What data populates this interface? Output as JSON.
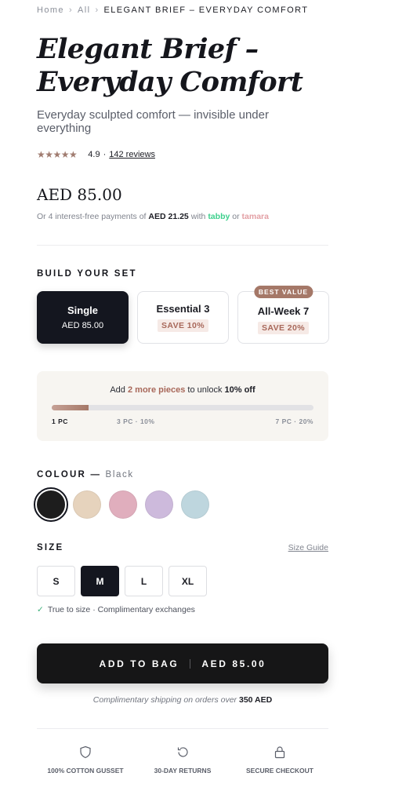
{
  "breadcrumb": {
    "home": "Home",
    "all": "All",
    "separator": "›",
    "current": "ELEGANT BRIEF – EVERYDAY COMFORT"
  },
  "product": {
    "title_line1": "Elegant Brief –",
    "title_line2": "Everyday Comfort",
    "subtitle": "Everyday sculpted comfort — invisible under everything",
    "stars": "★★★★★",
    "rating": "4.9",
    "rating_separator": "·",
    "reviews": "142 reviews",
    "price": "AED 85.00",
    "installments_prefix": "Or 4 interest-free payments of",
    "installment_amount": "AED 21.25",
    "installments_with": "with",
    "provider_1": "tabby",
    "installments_or": "or",
    "provider_2": "tamara"
  },
  "build_set": {
    "label": "BUILD YOUR SET",
    "options": [
      {
        "name": "Single",
        "detail": "AED 85.00",
        "selected": true
      },
      {
        "name": "Essential 3",
        "detail": "SAVE 10%"
      },
      {
        "name": "All-Week 7",
        "detail": "SAVE 20%",
        "badge": "BEST VALUE"
      }
    ]
  },
  "promo": {
    "prefix": "Add",
    "highlight": "2 more pieces",
    "middle": "to unlock",
    "reward": "10% off",
    "progress_fraction": 0.14,
    "ticks": [
      "1 PC",
      "3 PC · 10%",
      "7 PC · 20%"
    ]
  },
  "colour": {
    "label": "COLOUR",
    "dash": "—",
    "selected": "Black",
    "swatches": [
      "#1d1d1d",
      "#e6d3bd",
      "#e0aebd",
      "#cdbadc",
      "#bed6de"
    ]
  },
  "size": {
    "label": "SIZE",
    "guide": "Size Guide",
    "options": [
      "S",
      "M",
      "L",
      "XL"
    ],
    "selected": "M",
    "note": "True to size · Complimentary exchanges"
  },
  "cta": {
    "label": "ADD TO BAG",
    "price": "AED 85.00"
  },
  "shipping": {
    "text": "Complimentary shipping on orders over",
    "threshold": "350 AED"
  },
  "trust": [
    {
      "icon": "shield-icon",
      "label": "100% COTTON GUSSET"
    },
    {
      "icon": "returns-icon",
      "label": "30-DAY RETURNS"
    },
    {
      "icon": "lock-icon",
      "label": "SECURE CHECKOUT"
    }
  ],
  "colors": {
    "accent": "#a57868",
    "dark": "#14161f",
    "tabby": "#3dd08d",
    "tamara": "#e3a0a5"
  }
}
